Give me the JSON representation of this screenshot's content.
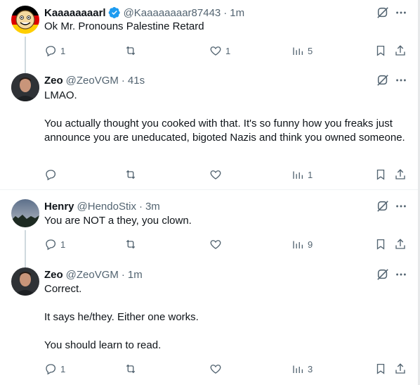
{
  "posts": [
    {
      "name": "Kaaaaaaaarl",
      "verified": true,
      "handle": "@Kaaaaaaaar87443",
      "time": "1m",
      "paragraphs": [
        "Ok Mr. Pronouns Palestine Retard"
      ],
      "replies": "1",
      "reposts": "",
      "likes": "1",
      "views": "5"
    },
    {
      "name": "Zeo",
      "verified": false,
      "handle": "@ZeoVGM",
      "time": "41s",
      "paragraphs": [
        "LMAO.",
        "",
        "You actually thought you cooked with that. It's so funny how you freaks just announce you are uneducated, bigoted Nazis and think you owned someone."
      ],
      "replies": "",
      "reposts": "",
      "likes": "",
      "views": "1"
    },
    {
      "name": "Henry",
      "verified": false,
      "handle": "@HendoStix",
      "time": "3m",
      "paragraphs": [
        "You are NOT a they, you clown."
      ],
      "replies": "1",
      "reposts": "",
      "likes": "",
      "views": "9"
    },
    {
      "name": "Zeo",
      "verified": false,
      "handle": "@ZeoVGM",
      "time": "1m",
      "paragraphs": [
        "Correct.",
        "",
        "It says he/they. Either one works.",
        "",
        "You should learn to read."
      ],
      "replies": "1",
      "reposts": "",
      "likes": "",
      "views": "3"
    }
  ],
  "separator": "·",
  "colors": {
    "text": "#0f1419",
    "secondary": "#536471",
    "verified": "#1d9bf0",
    "thread_line": "#cfd9de"
  },
  "icons": [
    "verified-badge-icon",
    "grok-icon",
    "more-icon",
    "reply-icon",
    "repost-icon",
    "like-icon",
    "views-icon",
    "bookmark-icon",
    "share-icon"
  ]
}
